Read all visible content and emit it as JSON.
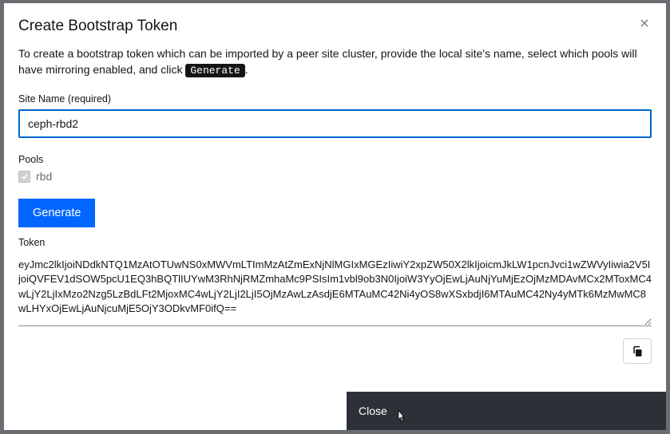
{
  "modal": {
    "title": "Create Bootstrap Token",
    "description_before": "To create a bootstrap token which can be imported by a peer site cluster, provide the local site's name, select which pools will have mirroring enabled, and click ",
    "description_code": "Generate",
    "description_after": "."
  },
  "form": {
    "site_name_label": "Site Name (required)",
    "site_name_value": "ceph-rbd2",
    "pools_label": "Pools",
    "pool_items": [
      {
        "label": "rbd",
        "checked": true,
        "disabled": true
      }
    ],
    "generate_label": "Generate",
    "token_label": "Token",
    "token_value": "eyJmc2lkIjoiNDdkNTQ1MzAtOTUwNS0xMWVmLTImMzAtZmExNjNlMGIxMGEzIiwiY2xpZW50X2lkIjoicmJkLW1pcnJvci1wZWVyIiwia2V5IjoiQVFEV1dSOW5pcU1EQ3hBQTlIUYwM3RhNjRMZmhaMc9PSIsIm1vbl9ob3N0IjoiW3YyOjEwLjAuNjYuMjEzOjMzMDAvMCx2MToxMC4wLjY2LjIxMzo2Nzg5LzBdLFt2MjoxMC4wLjY2LjI2LjI5OjMzAwLzAsdjE6MTAuMC42Ni4yOS8wXSxbdjI6MTAuMC42Ny4yMTk6MzMwMC8wLHYxOjEwLjAuNjcuMjE5OjY3ODkvMF0ifQ=="
  },
  "footer": {
    "close_label": "Close"
  },
  "icons": {
    "close": "close-icon",
    "check": "check-icon",
    "copy": "copy-icon"
  }
}
